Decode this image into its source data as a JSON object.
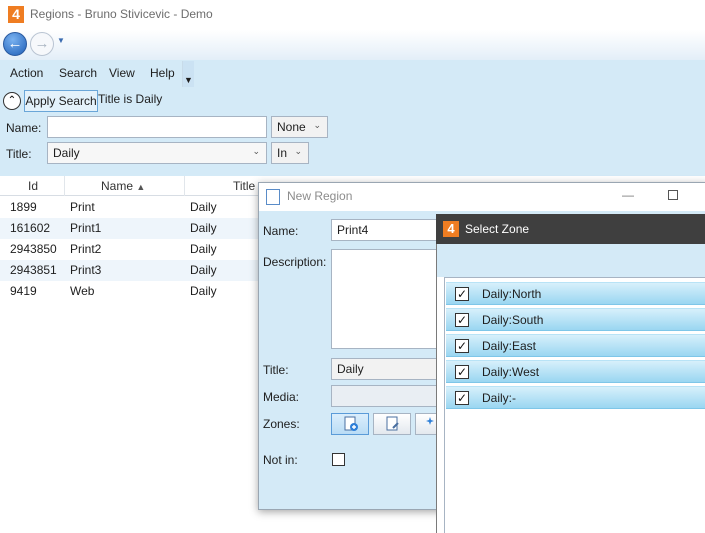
{
  "window": {
    "logo": "4",
    "title": "Regions - Bruno Stivicevic - Demo"
  },
  "nav": {
    "back_icon": "arrow-left-icon",
    "forward_icon": "arrow-right-icon"
  },
  "menu": {
    "items": [
      "Action",
      "Search",
      "View",
      "Help"
    ]
  },
  "search": {
    "apply_label": "Apply Search",
    "summary": "Title is Daily",
    "name_label": "Name:",
    "name_value": "",
    "name_operator": "None",
    "title_label": "Title:",
    "title_value": "Daily",
    "title_operator": "In"
  },
  "grid": {
    "columns": [
      "Id",
      "Name",
      "Title"
    ],
    "rows": [
      {
        "id": "1899",
        "name": "Print",
        "title": "Daily"
      },
      {
        "id": "161602",
        "name": "Print1",
        "title": "Daily"
      },
      {
        "id": "2943850",
        "name": "Print2",
        "title": "Daily"
      },
      {
        "id": "2943851",
        "name": "Print3",
        "title": "Daily"
      },
      {
        "id": "9419",
        "name": "Web",
        "title": "Daily"
      }
    ]
  },
  "new_region": {
    "title": "New Region",
    "name_label": "Name:",
    "name_value": "Print4",
    "description_label": "Description:",
    "description_value": "",
    "title_label": "Title:",
    "title_value": "Daily",
    "media_label": "Media:",
    "media_value": "",
    "zones_label": "Zones:",
    "not_in_label": "Not in:"
  },
  "select_zone": {
    "logo": "4",
    "title": "Select Zone",
    "zones": [
      {
        "label": "Daily:North",
        "check": "✓"
      },
      {
        "label": "Daily:South",
        "check": "✓"
      },
      {
        "label": "Daily:East",
        "check": "✓"
      },
      {
        "label": "Daily:West",
        "check": "✓"
      },
      {
        "label": "Daily:-",
        "check": "✓"
      }
    ]
  },
  "colors": {
    "panel": "#d4eaf7",
    "accent": "#ef7d22",
    "zone_highlight": "#9ad6f1"
  }
}
